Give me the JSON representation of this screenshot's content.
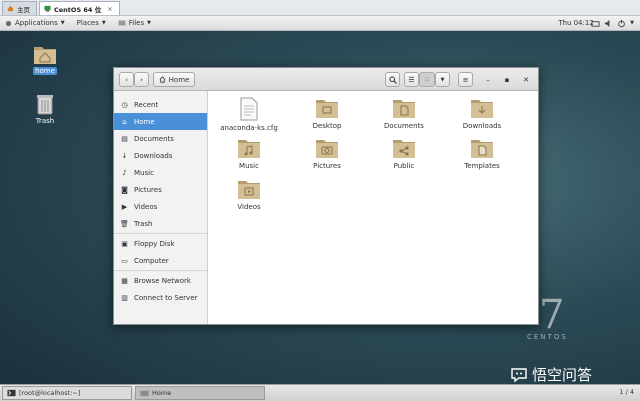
{
  "vm_tabs": [
    {
      "label": "主页",
      "active": false
    },
    {
      "label": "CentOS 64 位",
      "active": true
    }
  ],
  "topbar": {
    "applications": "Applications",
    "places": "Places",
    "files": "Files",
    "clock": "Thu 04:12"
  },
  "desktop_icons": [
    {
      "label": "home"
    },
    {
      "label": "Trash"
    }
  ],
  "window": {
    "location": "Home"
  },
  "sidebar": [
    {
      "label": "Recent"
    },
    {
      "label": "Home"
    },
    {
      "label": "Documents"
    },
    {
      "label": "Downloads"
    },
    {
      "label": "Music"
    },
    {
      "label": "Pictures"
    },
    {
      "label": "Videos"
    },
    {
      "label": "Trash"
    },
    {
      "label": "Floppy Disk"
    },
    {
      "label": "Computer"
    },
    {
      "label": "Browse Network"
    },
    {
      "label": "Connect to Server"
    }
  ],
  "files": [
    {
      "name": "anaconda-ks.cfg"
    },
    {
      "name": "Desktop"
    },
    {
      "name": "Documents"
    },
    {
      "name": "Downloads"
    },
    {
      "name": "Music"
    },
    {
      "name": "Pictures"
    },
    {
      "name": "Public"
    },
    {
      "name": "Templates"
    },
    {
      "name": "Videos"
    }
  ],
  "taskbar": {
    "terminal": "[root@localhost:~]",
    "home": "Home",
    "pager": "1 / 4"
  },
  "branding": {
    "number": "7",
    "word": "CENTOS"
  },
  "watermark": "悟空问答",
  "colors": {
    "selection": "#4a90d9",
    "folder": "#cbb68c"
  }
}
